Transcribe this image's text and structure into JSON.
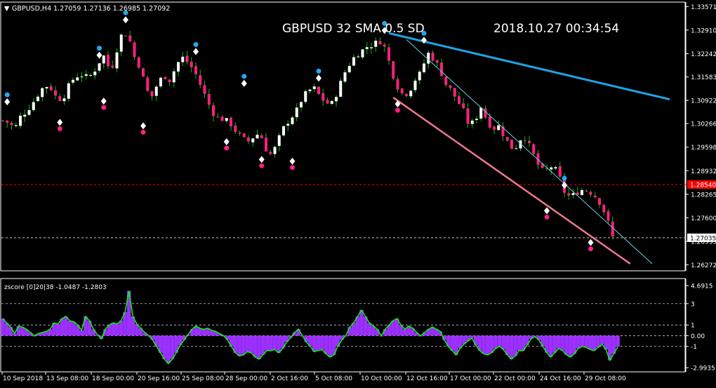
{
  "main_panel": {
    "symbol_header": "GBPUSD,H4  1.27059 1.27136 1.26985 1.27092",
    "overlay_title": "GBPUSD  32 SMA  0.5 SD",
    "timestamp": "2018.10.27 00:34:54",
    "price_ticks": [
      "1.33571",
      "1.32910",
      "1.32242",
      "1.31583",
      "1.30922",
      "1.30266",
      "1.29598",
      "1.28932",
      "1.28265",
      "1.27600",
      "1.26935",
      "1.26272"
    ],
    "price_tick_values": [
      1.33571,
      1.3291,
      1.32242,
      1.31583,
      1.30922,
      1.30266,
      1.29598,
      1.28932,
      1.28265,
      1.276,
      1.26935,
      1.26272
    ],
    "current_price_label": "1.27035",
    "current_price_value": 1.27035,
    "red_level_label": "1.28540",
    "red_level_value": 1.2854,
    "colors": {
      "bull": "#ffffff",
      "bear": "#ff1f7f",
      "wick": "#00c000",
      "trend_blue": "#1ea4e6",
      "trend_cyan": "#66d0e0",
      "trend_pink": "#f07890",
      "red_level": "#ff0000"
    }
  },
  "indicator_panel": {
    "header": "zscore [0]20|38 -1.0487 -1.2803",
    "ticks": [
      "4.6915",
      "3",
      "1",
      "0.00",
      "-1",
      "-2.9935"
    ],
    "tick_values": [
      4.6915,
      3,
      1,
      0,
      -1,
      -2.9935
    ],
    "colors": {
      "histogram": "#9b30ff",
      "line": "#00ff00",
      "levels": "#c8c8c8"
    }
  },
  "time_axis": {
    "labels": [
      "10 Sep 2018",
      "13 Sep 08:00",
      "18 Sep 00:00",
      "20 Sep 16:00",
      "25 Sep 08:00",
      "28 Sep 00:00",
      "2 Oct 16:00",
      "5 Oct 08:00",
      "10 Oct 00:00",
      "12 Oct 16:00",
      "17 Oct 00:00",
      "22 Oct 00:00",
      "24 Oct 16:00",
      "29 Oct 08:00"
    ]
  },
  "chart_data": {
    "type": "candlestick",
    "title": "GBPUSD  32 SMA  0.5 SD",
    "ylim": [
      1.261,
      1.337
    ],
    "close_path": [
      1.3035,
      1.3028,
      1.3012,
      1.3048,
      1.3062,
      1.3085,
      1.3112,
      1.3135,
      1.3128,
      1.3098,
      1.3096,
      1.3132,
      1.3158,
      1.3165,
      1.3158,
      1.3165,
      1.3198,
      1.322,
      1.317,
      1.3232,
      1.3285,
      1.3275,
      1.3215,
      1.3185,
      1.312,
      1.3103,
      1.3145,
      1.3162,
      1.3148,
      1.3192,
      1.3214,
      1.3198,
      1.3176,
      1.3138,
      1.3098,
      1.306,
      1.3042,
      1.3038,
      1.3028,
      1.3004,
      1.2985,
      1.2975,
      1.299,
      1.3,
      1.2955,
      1.2935,
      1.2978,
      1.3015,
      1.304,
      1.3058,
      1.3095,
      1.3118,
      1.3128,
      1.3104,
      1.3085,
      1.3082,
      1.3118,
      1.3165,
      1.3195,
      1.322,
      1.3232,
      1.3245,
      1.325,
      1.3262,
      1.3238,
      1.3176,
      1.3132,
      1.3106,
      1.3118,
      1.3152,
      1.3172,
      1.3228,
      1.321,
      1.3185,
      1.314,
      1.312,
      1.3092,
      1.3064,
      1.302,
      1.3036,
      1.3075,
      1.3034,
      1.3012,
      1.302,
      1.2986,
      1.2958,
      1.2962,
      1.2998,
      1.2965,
      1.293,
      1.2892,
      1.2895,
      1.2908,
      1.288,
      1.283,
      1.2818,
      1.2832,
      1.284,
      1.2836,
      1.2822,
      1.28,
      1.276,
      1.2705
    ],
    "swing_markers": [
      {
        "type": "high",
        "idx": 1,
        "price": 1.3088
      },
      {
        "type": "low",
        "idx": 13,
        "price": 1.303
      },
      {
        "type": "high",
        "idx": 22,
        "price": 1.322
      },
      {
        "type": "low",
        "idx": 23,
        "price": 1.309
      },
      {
        "type": "high",
        "idx": 28,
        "price": 1.332
      },
      {
        "type": "low",
        "idx": 32,
        "price": 1.302
      },
      {
        "type": "high",
        "idx": 44,
        "price": 1.323
      },
      {
        "type": "low",
        "idx": 51,
        "price": 1.2975
      },
      {
        "type": "high",
        "idx": 55,
        "price": 1.314
      },
      {
        "type": "low",
        "idx": 59,
        "price": 1.2925
      },
      {
        "type": "low",
        "idx": 66,
        "price": 1.292
      },
      {
        "type": "high",
        "idx": 72,
        "price": 1.3155
      },
      {
        "type": "high",
        "idx": 87,
        "price": 1.329
      },
      {
        "type": "low",
        "idx": 90,
        "price": 1.3082
      },
      {
        "type": "high",
        "idx": 96,
        "price": 1.3262
      },
      {
        "type": "high",
        "idx": 128,
        "price": 1.2852
      },
      {
        "type": "low",
        "idx": 124,
        "price": 1.278
      },
      {
        "type": "low",
        "idx": 134,
        "price": 1.269
      }
    ],
    "trendlines": [
      {
        "name": "blue",
        "from": {
          "idx": 88,
          "price": 1.3282
        },
        "to": {
          "idx": 152,
          "price": 1.3095
        }
      },
      {
        "name": "cyan",
        "from": {
          "idx": 92,
          "price": 1.3264
        },
        "to": {
          "idx": 148,
          "price": 1.263
        }
      },
      {
        "name": "pink",
        "from": {
          "idx": 89,
          "price": 1.31
        },
        "to": {
          "idx": 143,
          "price": 1.263
        }
      }
    ],
    "zscore_series": [
      1.6,
      1.2,
      0.8,
      0.2,
      0.9,
      0.8,
      0.6,
      0.3,
      0.0,
      0.2,
      0.3,
      0.4,
      0.6,
      1.2,
      1.1,
      1.6,
      1.8,
      1.4,
      1.3,
      1.0,
      0.5,
      1.8,
      1.4,
      0.6,
      0.1,
      -0.3,
      0.6,
      1.0,
      1.2,
      1.1,
      1.4,
      2.2,
      4.2,
      1.8,
      1.1,
      0.7,
      0.3,
      0.0,
      -0.4,
      -1.0,
      -1.6,
      -2.2,
      -2.6,
      -2.2,
      -1.6,
      -0.9,
      -0.4,
      0.1,
      0.6,
      0.9,
      0.7,
      0.6,
      0.7,
      0.5,
      0.4,
      0.2,
      0.0,
      -0.4,
      -1.0,
      -1.6,
      -1.9,
      -1.8,
      -1.5,
      -1.6,
      -2.0,
      -2.2,
      -1.8,
      -1.4,
      -1.4,
      -1.3,
      -1.6,
      -1.2,
      -0.6,
      -0.2,
      0.3,
      0.6,
      0.0,
      -0.6,
      -1.0,
      -1.5,
      -1.4,
      -1.3,
      -1.7,
      -2.0,
      -1.8,
      -1.0,
      -0.4,
      0.0,
      0.8,
      1.2,
      1.8,
      2.4,
      1.8,
      1.2,
      0.9,
      0.6,
      0.0,
      0.6,
      1.0,
      1.4,
      1.6,
      1.0,
      0.6,
      0.9,
      0.7,
      0.3,
      0.0,
      0.3,
      0.6,
      0.8,
      0.6,
      0.4,
      -0.4,
      -1.0,
      -1.4,
      -1.8,
      -1.2,
      -0.8,
      -0.5,
      -0.2,
      -0.9,
      -1.4,
      -1.7,
      -1.8,
      -1.6,
      -1.2,
      -1.0,
      -1.3,
      -1.8,
      -2.2,
      -1.9,
      -1.4,
      -1.4,
      -0.9,
      -0.3,
      -0.1,
      -0.4,
      -1.0,
      -1.6,
      -2.0,
      -1.6,
      -1.2,
      -1.4,
      -1.8,
      -2.0,
      -1.7,
      -1.2,
      -1.0,
      -1.1,
      -1.3,
      -1.4,
      -1.1,
      -0.8,
      -1.3,
      -2.3,
      -1.7,
      -1.05
    ],
    "indicator_ylim": [
      -2.9935,
      4.6915
    ]
  }
}
